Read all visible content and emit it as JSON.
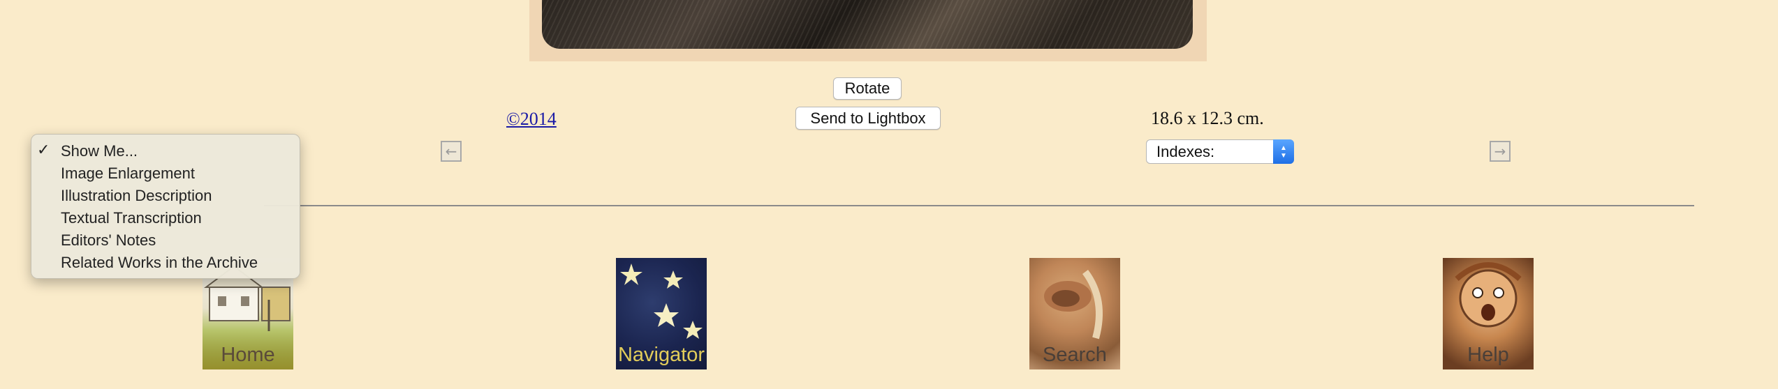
{
  "controls": {
    "rotate_label": "Rotate",
    "lightbox_label": "Send to Lightbox",
    "copyright_link": "©2014",
    "dimensions": "18.6 x 12.3 cm."
  },
  "show_me_menu": {
    "selected": "Show Me...",
    "items": [
      "Show Me...",
      "Image Enlargement",
      "Illustration Description",
      "Textual Transcription",
      "Editors' Notes",
      "Related Works in the Archive"
    ]
  },
  "indexes_select": {
    "value": "Indexes:"
  },
  "nav_icons": [
    {
      "label": "Home",
      "color": "#5a4a3a"
    },
    {
      "label": "Navigator",
      "color": "#e2cc5a"
    },
    {
      "label": "Search",
      "color": "#4a3f38"
    },
    {
      "label": "Help",
      "color": "#4a3f38"
    }
  ],
  "colors": {
    "background": "#faebca",
    "link": "#1a1aa6",
    "select_accent": "#2f86f5"
  }
}
